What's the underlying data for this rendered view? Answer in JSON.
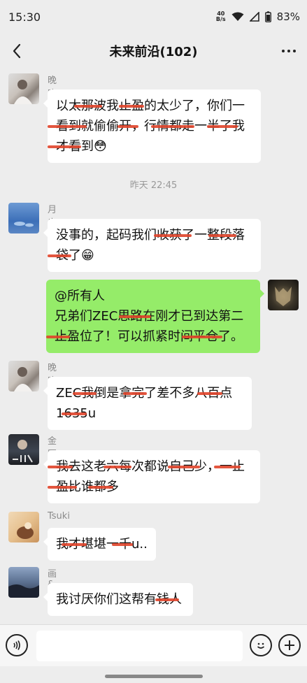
{
  "status_bar": {
    "time": "15:30",
    "net_speed_top": "40",
    "net_speed_bottom": "B/s",
    "battery": "83%"
  },
  "header": {
    "title": "未来前沿(102)"
  },
  "messages": [
    {
      "sender": "晚晚",
      "lines": [
        "以太那波我止盈的太少了，你们一",
        "看到就偷偷开，行情都走一半了我",
        "才看到😳"
      ]
    },
    {
      "sender": "月出",
      "lines": [
        "没事的，起码我们收获了一整段落",
        "袋了😁"
      ]
    },
    {
      "sender": "",
      "lines": [
        "@所有人",
        "兄弟们ZEC思路在刚才已到达第二",
        "止盈位了！可以抓紧时间平仓了。"
      ]
    },
    {
      "sender": "晚晚",
      "lines": [
        "ZEC我倒是拿完了差不多八百点",
        "1635u"
      ]
    },
    {
      "sender": "金匮",
      "lines": [
        "我去这老六每次都说自己少，一止",
        "盈比谁都多"
      ]
    },
    {
      "sender": "Tsuki",
      "lines": [
        "我才堪堪一千u.."
      ]
    },
    {
      "sender": "画&",
      "lines": [
        "我讨厌你们这帮有钱人"
      ]
    }
  ],
  "timestamp": "昨天 22:45",
  "colors": {
    "background": "#ededed",
    "self_bubble": "#95ec69",
    "other_bubble": "#ffffff",
    "redaction": "#e0442a"
  }
}
